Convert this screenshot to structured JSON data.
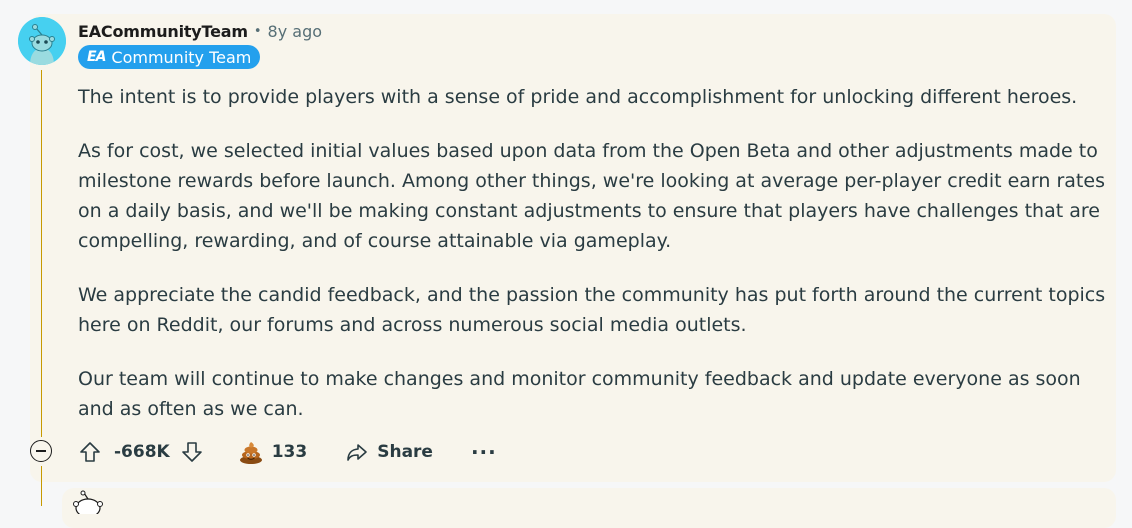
{
  "comment": {
    "username": "EACommunityTeam",
    "separator": "•",
    "age": "8y ago",
    "flair": {
      "logo_text": "EA",
      "label": "Community Team",
      "color": "#24a0ed"
    },
    "paragraphs": [
      "The intent is to provide players with a sense of pride and accomplishment for unlocking different heroes.",
      "As for cost, we selected initial values based upon data from the Open Beta and other adjustments made to milestone rewards before launch. Among other things, we're looking at average per-player credit earn rates on a daily basis, and we'll be making constant adjustments to ensure that players have challenges that are compelling, rewarding, and of course attainable via gameplay.",
      "We appreciate the candid feedback, and the passion the community has put forth around the current topics here on Reddit, our forums and across numerous social media outlets.",
      "Our team will continue to make changes and monitor community feedback and update everyone as soon and as often as we can."
    ],
    "actions": {
      "score": "-668K",
      "award_count": "133",
      "share_label": "Share",
      "more_label": "···"
    }
  },
  "icons": {
    "avatar": "snoo-avatar-icon",
    "upvote": "upvote-arrow-icon",
    "downvote": "downvote-arrow-icon",
    "award": "poop-award-icon",
    "share": "share-arrow-icon",
    "collapse": "collapse-minus-icon",
    "more": "more-dots-icon"
  },
  "colors": {
    "avatar_bg": "#46d0f0",
    "thread_line": "#c79a00",
    "card_bg": "#f8f5ec"
  }
}
